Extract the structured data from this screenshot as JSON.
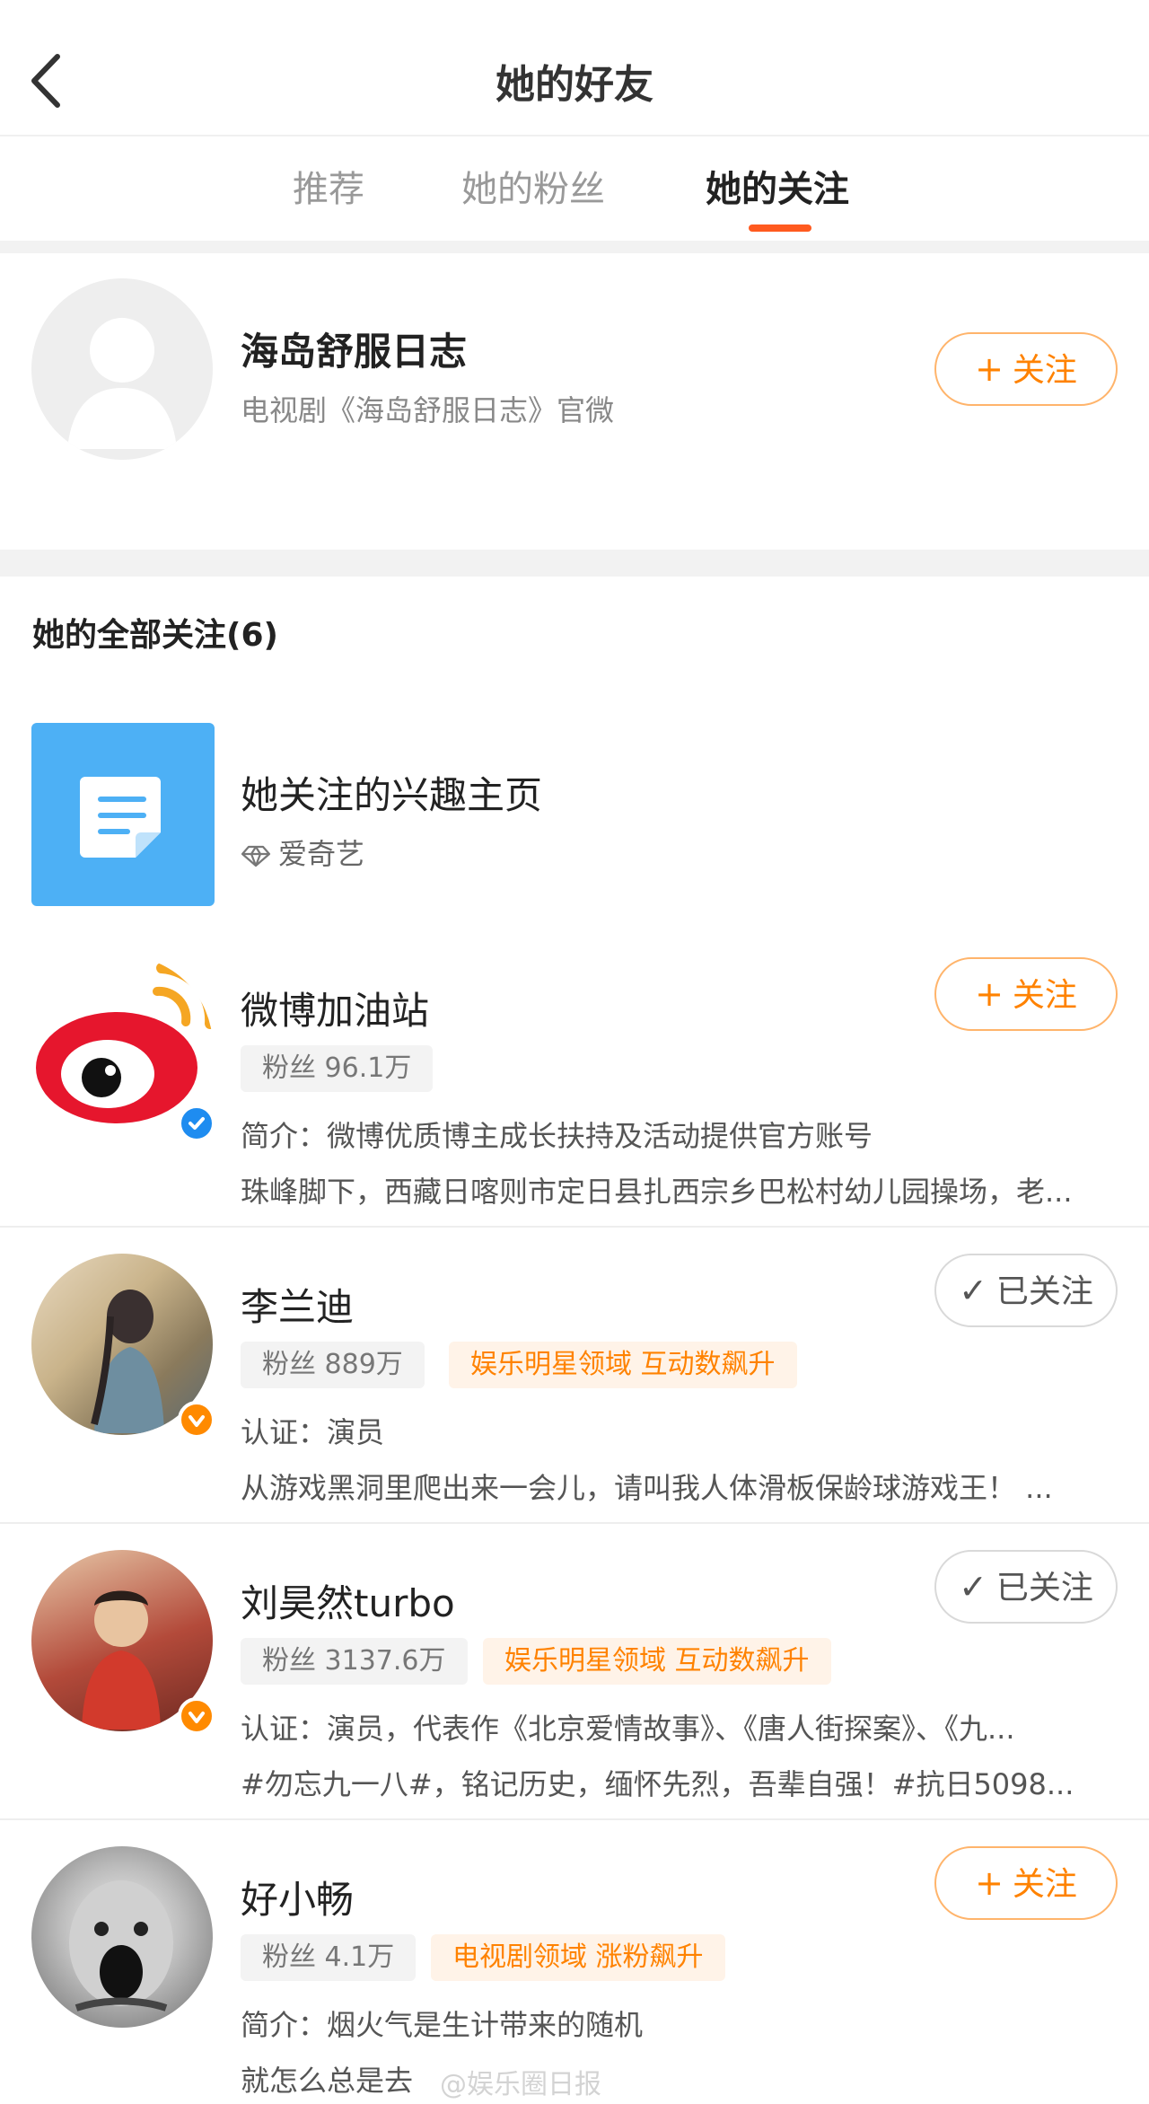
{
  "header": {
    "title": "她的好友"
  },
  "tabs": [
    {
      "label": "推荐",
      "active": false
    },
    {
      "label": "她的粉丝",
      "active": false
    },
    {
      "label": "她的关注",
      "active": true
    }
  ],
  "featured": {
    "name": "海岛舒服日志",
    "desc": "电视剧《海岛舒服日志》官微",
    "follow_label": "关注"
  },
  "section_title": "她的全部关注(6)",
  "interest": {
    "title": "她关注的兴趣主页",
    "source": "爱奇艺"
  },
  "users": [
    {
      "name": "微博加油站",
      "fans": "粉丝 96.1万",
      "tag": "",
      "line1": "简介：微博优质博主成长扶持及活动提供官方账号",
      "line2": "珠峰脚下，西藏日喀则市定日县扎西宗乡巴松村幼儿园操场，老...",
      "verified": "blue",
      "follow_label": "关注",
      "followed": false
    },
    {
      "name": "李兰迪",
      "fans": "粉丝 889万",
      "tag": "娱乐明星领域 互动数飙升",
      "line1": "认证：演员",
      "line2": "从游戏黑洞里爬出来一会儿，请叫我人体滑板保龄球游戏王！ ...",
      "verified": "orange",
      "follow_label": "已关注",
      "followed": true
    },
    {
      "name": "刘昊然turbo",
      "fans": "粉丝 3137.6万",
      "tag": "娱乐明星领域 互动数飙升",
      "line1": "认证：演员，代表作《北京爱情故事》、《唐人街探案》、《九...",
      "line2": "#勿忘九一八#，铭记历史，缅怀先烈，吾辈自强！#抗日5098...",
      "verified": "orange",
      "follow_label": "已关注",
      "followed": true
    },
    {
      "name": "好小畅",
      "fans": "粉丝 4.1万",
      "tag": "电视剧领域 涨粉飙升",
      "line1": "简介：烟火气是生计带来的随机",
      "line2": "就怎么总是去",
      "verified": "",
      "follow_label": "关注",
      "followed": false
    }
  ],
  "watermark": "@娱乐圈日报",
  "colors": {
    "accent": "#ff8200",
    "indicator": "#ff5a1f",
    "verified_blue": "#1e8cf0",
    "verified_orange": "#ff8a00"
  }
}
